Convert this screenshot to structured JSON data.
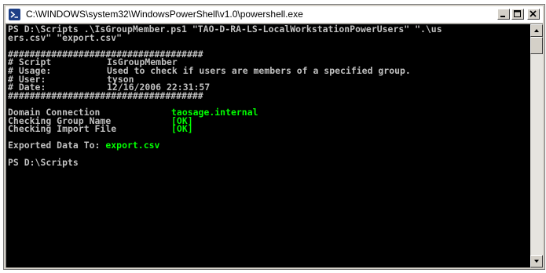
{
  "window": {
    "title": "C:\\WINDOWS\\system32\\WindowsPowerShell\\v1.0\\powershell.exe",
    "icon": "powershell-icon",
    "buttons": [
      "minimize-icon",
      "maximize-icon",
      "close-icon"
    ]
  },
  "console": {
    "command_line_1": "PS D:\\Scripts .\\IsGroupMember.ps1 \"TAO-D-RA-LS-LocalWorkstationPowerUsers\" \".\\us",
    "command_line_2": "ers.csv\" \"export.csv\"",
    "hash_line": "####################################",
    "header": [
      {
        "label": "# Script",
        "value": "IsGroupMember"
      },
      {
        "label": "# Usage:",
        "value": "Used to check if users are members of a specified group."
      },
      {
        "label": "# User:",
        "value": "tyson"
      },
      {
        "label": "# Date:",
        "value": "12/16/2006 22:31:57"
      }
    ],
    "checks": [
      {
        "label": "Domain Connection",
        "value": "taosage.internal"
      },
      {
        "label": "Checking Group Name",
        "value": "[OK]"
      },
      {
        "label": "Checking Import File",
        "value": "[OK]"
      }
    ],
    "export_label": "Exported Data To: ",
    "export_value": "export.csv",
    "prompt": "PS D:\\Scripts"
  },
  "colors": {
    "background": "#000000",
    "text": "#c0c0c0",
    "highlight": "#00ff00"
  }
}
